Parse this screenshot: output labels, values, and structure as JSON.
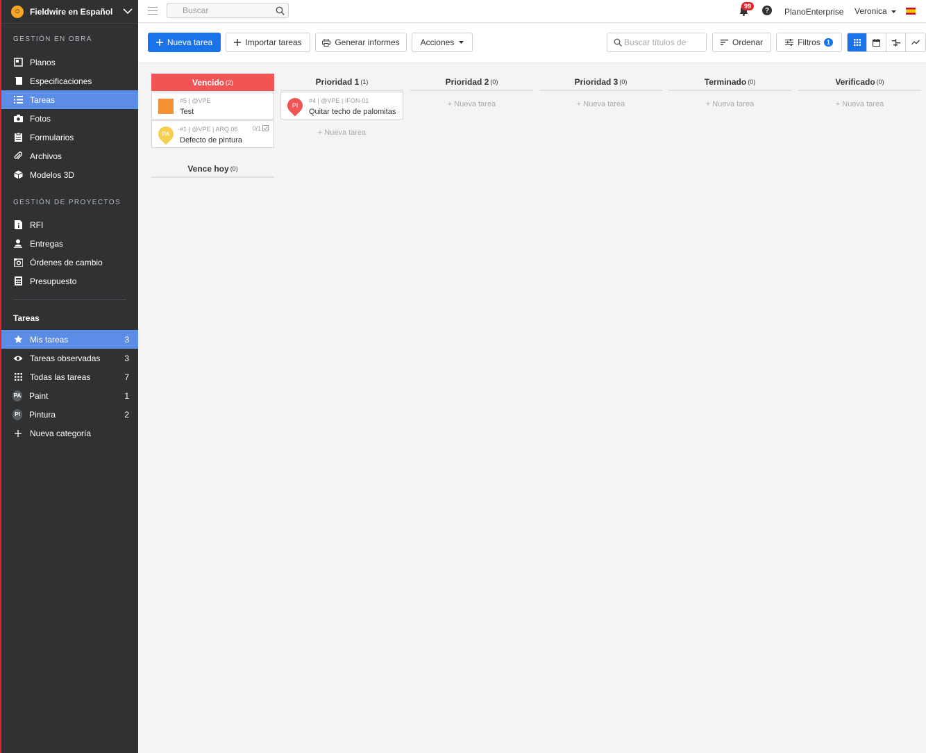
{
  "brand": {
    "name": "Fieldwire en Español"
  },
  "sidebar": {
    "section_obra": "GESTIÓN EN OBRA",
    "obra_items": [
      {
        "label": "Planos",
        "icon": "plans-icon"
      },
      {
        "label": "Especificaciones",
        "icon": "specs-icon"
      },
      {
        "label": "Tareas",
        "icon": "tasks-icon"
      },
      {
        "label": "Fotos",
        "icon": "camera-icon"
      },
      {
        "label": "Formularios",
        "icon": "clipboard-icon"
      },
      {
        "label": "Archivos",
        "icon": "paperclip-icon"
      },
      {
        "label": "Modelos 3D",
        "icon": "cube-icon"
      }
    ],
    "section_proyectos": "GESTIÓN DE PROYECTOS",
    "proyecto_items": [
      {
        "label": "RFI",
        "icon": "rfi-icon"
      },
      {
        "label": "Entregas",
        "icon": "person-icon"
      },
      {
        "label": "Órdenes de cambio",
        "icon": "change-order-icon"
      },
      {
        "label": "Presupuesto",
        "icon": "calculator-icon"
      }
    ],
    "section_tareas": "Tareas",
    "task_items": [
      {
        "label": "Mis tareas",
        "count": "3",
        "icon": "star-icon"
      },
      {
        "label": "Tareas observadas",
        "count": "3",
        "icon": "eye-icon"
      },
      {
        "label": "Todas las tareas",
        "count": "7",
        "icon": "grid-dots-icon"
      },
      {
        "label": "Paint",
        "count": "1",
        "avatar": "PA"
      },
      {
        "label": "Pintura",
        "count": "2",
        "avatar": "PI"
      },
      {
        "label": "Nueva categoría",
        "count": "",
        "icon": "plus-icon"
      }
    ]
  },
  "topbar": {
    "search_placeholder": "Buscar",
    "notifications": "99",
    "help": "?",
    "plan": "PlanoEnterprise",
    "user": "Veronica"
  },
  "toolbar": {
    "new_task": "Nueva tarea",
    "import": "Importar tareas",
    "reports": "Generar informes",
    "actions": "Acciones",
    "search_placeholder": "Buscar títulos de",
    "sort": "Ordenar",
    "filters": "Filtros",
    "filters_count": "1"
  },
  "board": {
    "new_task_label": "+ Nueva tarea",
    "columns": [
      {
        "title": "Vencido",
        "count": "(2)"
      },
      {
        "title": "Prioridad 1",
        "count": "(1)"
      },
      {
        "title": "Prioridad 2",
        "count": "(0)"
      },
      {
        "title": "Prioridad 3",
        "count": "(0)"
      },
      {
        "title": "Terminado",
        "count": "(0)"
      },
      {
        "title": "Verificado",
        "count": "(0)"
      },
      {
        "title": "Vence hoy",
        "count": "(0)"
      }
    ],
    "cards": [
      {
        "meta": "#5 | @VPE",
        "title": "Test"
      },
      {
        "meta": "#1 | @VPE | ARQ.06",
        "title": "Defecto de pintura",
        "ratio": "0/1",
        "avatar": "PA"
      },
      {
        "meta": "#4 | @VPE | IFON-01",
        "title": "Quitar techo de palomitas",
        "avatar": "PI"
      }
    ]
  },
  "colors": {
    "accent": "#1a73e8",
    "overdue": "#f05454",
    "sidebar": "#2f3133",
    "active": "#5b8de6"
  }
}
